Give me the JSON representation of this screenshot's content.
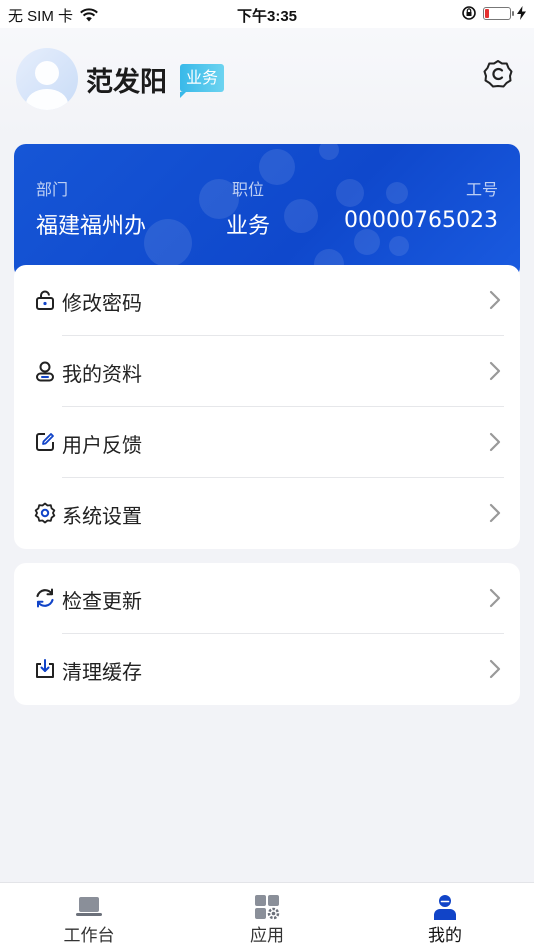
{
  "status_bar": {
    "carrier": "无 SIM 卡",
    "time": "下午3:35",
    "battery_level": 0.15,
    "battery_color": "#e5302f"
  },
  "profile": {
    "name": "范发阳",
    "role_badge": "业务",
    "settings_icon": "settings-c-icon"
  },
  "info_card": {
    "department_label": "部门",
    "department_value": "福建福州办",
    "position_label": "职位",
    "position_value": "业务",
    "employee_id_label": "工号",
    "employee_id_value": "00000765023",
    "background_color": "#1252d4"
  },
  "menu_group_1": [
    {
      "label": "修改密码",
      "icon": "lock-icon"
    },
    {
      "label": "我的资料",
      "icon": "user-icon"
    },
    {
      "label": "用户反馈",
      "icon": "edit-icon"
    },
    {
      "label": "系统设置",
      "icon": "gear-icon"
    }
  ],
  "menu_group_2": [
    {
      "label": "检查更新",
      "icon": "refresh-icon"
    },
    {
      "label": "清理缓存",
      "icon": "download-icon"
    }
  ],
  "tabbar": [
    {
      "label": "工作台",
      "icon": "laptop-icon",
      "active": false
    },
    {
      "label": "应用",
      "icon": "apps-icon",
      "active": false
    },
    {
      "label": "我的",
      "icon": "person-icon",
      "active": true
    }
  ],
  "accent_color": "#1144c8"
}
